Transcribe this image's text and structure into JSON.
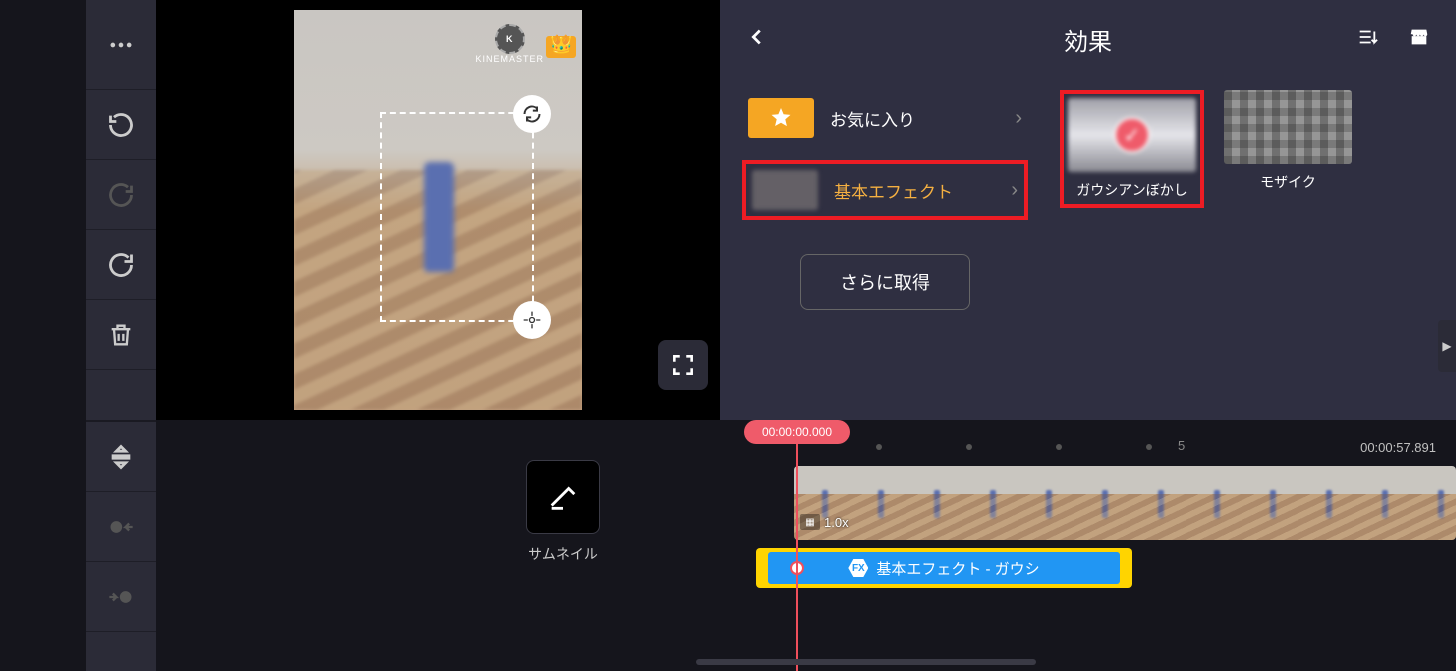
{
  "watermark": "KINEMASTER",
  "panel": {
    "title": "効果",
    "favorites": "お気に入り",
    "basic_effects": "基本エフェクト",
    "get_more": "さらに取得",
    "tiles": {
      "gaussian": "ガウシアンぼかし",
      "mosaic": "モザイク"
    }
  },
  "timeline": {
    "thumbnail_label": "サムネイル",
    "playhead_time": "00:00:00.000",
    "duration": "00:00:57.891",
    "marker_5": "5",
    "speed": "1.0x",
    "fx_clip": "基本エフェクト - ガウシ"
  }
}
